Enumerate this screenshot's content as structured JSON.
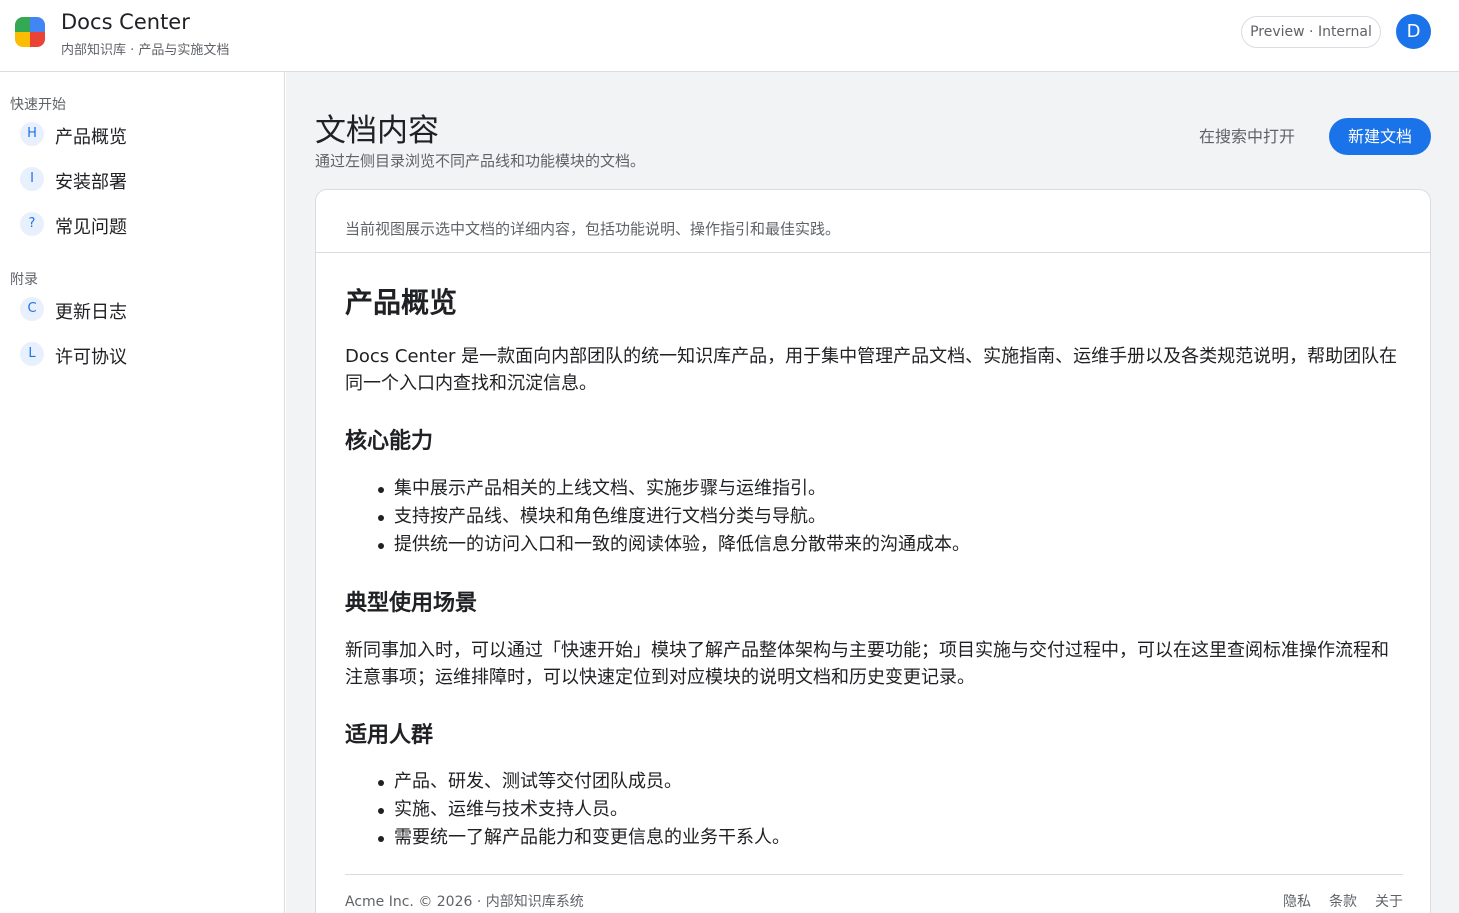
{
  "header": {
    "app_title": "Docs Center",
    "app_subtitle": "内部知识库 · 产品与实施文档",
    "env_chip": "Preview · Internal",
    "avatar_initial": "D"
  },
  "sidebar": {
    "sections": [
      {
        "title": "快速开始",
        "items": [
          {
            "badge": "H",
            "label": "产品概览"
          },
          {
            "badge": "I",
            "label": "安装部署"
          },
          {
            "badge": "?",
            "label": "常见问题"
          }
        ]
      },
      {
        "title": "附录",
        "items": [
          {
            "badge": "C",
            "label": "更新日志"
          },
          {
            "badge": "L",
            "label": "许可协议"
          }
        ]
      }
    ]
  },
  "main": {
    "title": "文档内容",
    "description": "通过左侧目录浏览不同产品线和功能模块的文档。",
    "open_in_search_label": "在搜索中打开",
    "new_doc_label": "新建文档",
    "card_intro": "当前视图展示选中文档的详细内容，包括功能说明、操作指引和最佳实践。",
    "doc": {
      "h1": "产品概览",
      "intro": "Docs Center 是一款面向内部团队的统一知识库产品，用于集中管理产品文档、实施指南、运维手册以及各类规范说明，帮助团队在同一个入口内查找和沉淀信息。",
      "sections": [
        {
          "heading": "核心能力",
          "bullets": [
            "集中展示产品相关的上线文档、实施步骤与运维指引。",
            "支持按产品线、模块和角色维度进行文档分类与导航。",
            "提供统一的访问入口和一致的阅读体验，降低信息分散带来的沟通成本。"
          ]
        },
        {
          "heading": "典型使用场景",
          "paragraph": "新同事加入时，可以通过「快速开始」模块了解产品整体架构与主要功能；项目实施与交付过程中，可以在这里查阅标准操作流程和注意事项；运维排障时，可以快速定位到对应模块的说明文档和历史变更记录。"
        },
        {
          "heading": "适用人群",
          "bullets": [
            "产品、研发、测试等交付团队成员。",
            "实施、运维与技术支持人员。",
            "需要统一了解产品能力和变更信息的业务干系人。"
          ]
        }
      ]
    },
    "footer": {
      "copyright": "Acme Inc. © 2026 · 内部知识库系统",
      "links": [
        "隐私",
        "条款",
        "关于"
      ]
    }
  },
  "colors": {
    "accent": "#1a73e8",
    "badge_bg": "#e8f0fe",
    "main_bg": "#f1f3f4",
    "border": "#dadce0",
    "text_primary": "#202124",
    "text_secondary": "#5f6368"
  }
}
